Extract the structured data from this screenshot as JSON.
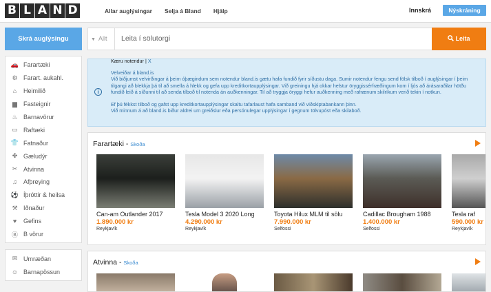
{
  "header": {
    "logo_letters": [
      "B",
      "L",
      "A",
      "N",
      "D"
    ],
    "nav": [
      "Allar auglýsingar",
      "Selja á Bland",
      "Hjálp"
    ],
    "login": "Innskrá",
    "signup": "Nýskráning"
  },
  "sidebar": {
    "post_button": "Skrá auglýsingu",
    "categories": [
      {
        "label": "Farartæki",
        "icon": "car-icon"
      },
      {
        "label": "Farart. aukahl.",
        "icon": "wheel-icon"
      },
      {
        "label": "Heimilið",
        "icon": "home-icon"
      },
      {
        "label": "Fasteignir",
        "icon": "building-icon"
      },
      {
        "label": "Barnavörur",
        "icon": "stroller-icon"
      },
      {
        "label": "Raftæki",
        "icon": "monitor-icon"
      },
      {
        "label": "Fatnaður",
        "icon": "shirt-icon"
      },
      {
        "label": "Gæludýr",
        "icon": "paw-icon"
      },
      {
        "label": "Atvinna",
        "icon": "tools-icon"
      },
      {
        "label": "Afþreying",
        "icon": "music-icon"
      },
      {
        "label": "Íþróttir & heilsa",
        "icon": "ball-icon"
      },
      {
        "label": "Iðnaður",
        "icon": "factory-icon"
      },
      {
        "label": "Gefins",
        "icon": "heart-icon"
      },
      {
        "label": "B vörur",
        "icon": "b-icon"
      }
    ],
    "extra": [
      {
        "label": "Umræðan",
        "icon": "chat-icon"
      },
      {
        "label": "Barnapössun",
        "icon": "baby-icon"
      }
    ]
  },
  "search": {
    "scope": "Allt",
    "placeholder": "Leita í sölutorgi",
    "button": "Leita"
  },
  "notice": {
    "greeting": "Kæru notendur",
    "close": "X",
    "paragraphs": [
      "Velveiðar á bland.is",
      "Við biðjumst velvirðingar á þeim óþægindum sem notendur bland.is gætu hafa fundið fyrir síðustu daga. Sumir notendur fengu send fölsk tilboð í auglýsingar í þeim tilgangi að blekkja þá til að smella á hlekk og gefa upp kreditkortaupplýsingar. Við greiningu hjá okkar helstur öryggissérfræðingum kom í ljós að árásaraðilar hötðu fundið leið á síðunni til að senda tilboð til notenda án auðkenningar. Til að tryggja öryggi hefur auðkenning með rafrænum skilríkum verið tekin í notkun.",
      "Ef þú fékkst tilboð og gafst upp kreditkortaupplýsingar skaltu tafarlaust hafa samband við viðskiptabankann þinn.",
      "Við minnum á að bland.is biður aldrei um greiðslur eða persónulegar upplýsingar í gegnum tölvupóst eða skilaboð."
    ]
  },
  "sections": [
    {
      "title": "Farartæki",
      "see": "Skoða",
      "items": [
        {
          "title": "Can-am Outlander 2017",
          "price": "1.890.000 kr",
          "location": "Reykjavík",
          "colors": [
            "#3b3f3a",
            "#7a7d73",
            "#1c1f1c"
          ]
        },
        {
          "title": "Tesla Model 3 2020 Long",
          "price": "4.290.000 kr",
          "location": "Reykjavík",
          "colors": [
            "#e7e7e7",
            "#9aa0a6",
            "#f3f3f3"
          ]
        },
        {
          "title": "Toyota Hilux MLM til sölu",
          "price": "7.990.000 kr",
          "location": "Selfossi",
          "colors": [
            "#6d8aa8",
            "#2d2f2c",
            "#8a6a45"
          ]
        },
        {
          "title": "Cadillac Brougham 1988",
          "price": "1.400.000 kr",
          "location": "Selfossi",
          "colors": [
            "#9aa6b0",
            "#3e2f2a",
            "#5b5b55"
          ]
        },
        {
          "title": "Tesla raf",
          "price": "590.000 kr",
          "location": "Reykjavík",
          "colors": [
            "#a9a9a9",
            "#555",
            "#cfcfcf"
          ]
        }
      ]
    },
    {
      "title": "Atvinna",
      "see": "Skoða"
    }
  ]
}
